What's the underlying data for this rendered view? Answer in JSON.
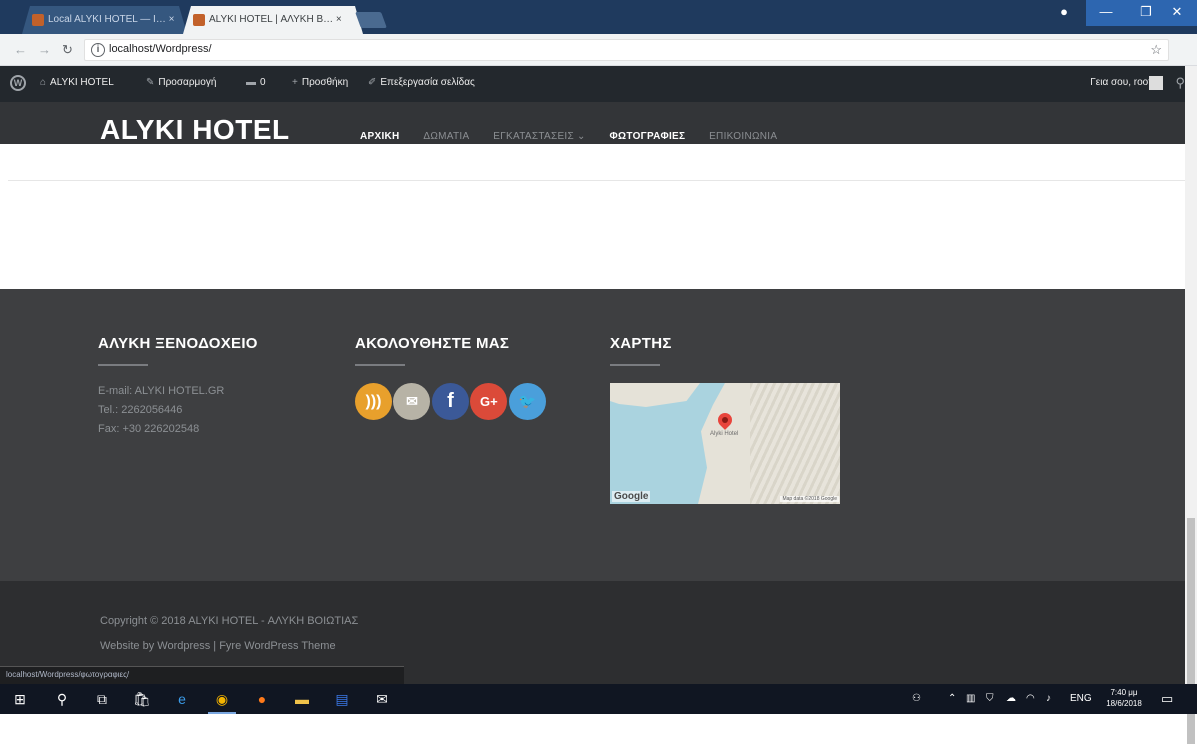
{
  "browser": {
    "tabs": [
      {
        "label": "Local ALYKI HOTEL — Ι… ×"
      },
      {
        "label": "ALYKI HOTEL | ΑΛΥΚΗ Β… ×"
      }
    ],
    "url": "localhost/Wordpress/",
    "window_controls": {
      "minimize": "—",
      "maximize": "❐",
      "close": "✕"
    }
  },
  "adminbar": {
    "site_name": "ALYKI HOTEL",
    "customize": "Προσαρμογή",
    "comments_count": "0",
    "new": "Προσθήκη",
    "edit_page": "Επεξεργασία σελίδας",
    "account": "Γεια σου, root"
  },
  "header": {
    "logo": "ALYKI HOTEL",
    "nav": [
      "ΑΡΧΙΚΗ",
      "ΔΩΜΑΤΙΑ",
      "ΕΓΚΑΤΑΣΤΑΣΕΙΣ ⌄",
      "ΦΩΤΟΓΡΑΦΙΕΣ",
      "ΕΠΙΚΟΙΝΩΝΙΑ"
    ]
  },
  "footer": {
    "col1": {
      "title": "ΑΛΥΚΗ ΞΕΝΟΔΟΧΕΙΟ",
      "email": "E-mail: ALYKI HOTEL.GR",
      "tel": "Tel.: 2262056446",
      "fax": "Fax: +30 226202548"
    },
    "col2": {
      "title": "ΑΚΟΛΟΥΘΗΣΤΕ ΜΑΣ",
      "icons": [
        "rss-icon",
        "email-icon",
        "facebook-icon",
        "google-plus-icon",
        "twitter-icon"
      ],
      "icon_glyphs": {
        "rss": ")))",
        "mail": "✉",
        "fb": "f",
        "gp": "G+",
        "tw": "🐦"
      },
      "icon_colors": {
        "rss": "#e8a02c",
        "mail": "#b7b3a6",
        "fb": "#3b5998",
        "gp": "#db4a39",
        "tw": "#4a9fdb"
      }
    },
    "col3": {
      "title": "ΧΑΡΤΗΣ",
      "map_place": "Alyki Hotel",
      "map_logo": "Google",
      "map_attribution": "Map data ©2018 Google"
    }
  },
  "copyright": {
    "line1": "Copyright © 2018 ALYKI HOTEL - ΑΛΥΚΗ ΒΟΙΩΤΙΑΣ",
    "line2": "Website by Wordpress | Fyre WordPress Theme"
  },
  "status_url": "localhost/Wordpress/φωτογραφιες/",
  "taskbar": {
    "tray": "ENG",
    "time": "7:40 μμ",
    "date": "18/6/2018"
  }
}
